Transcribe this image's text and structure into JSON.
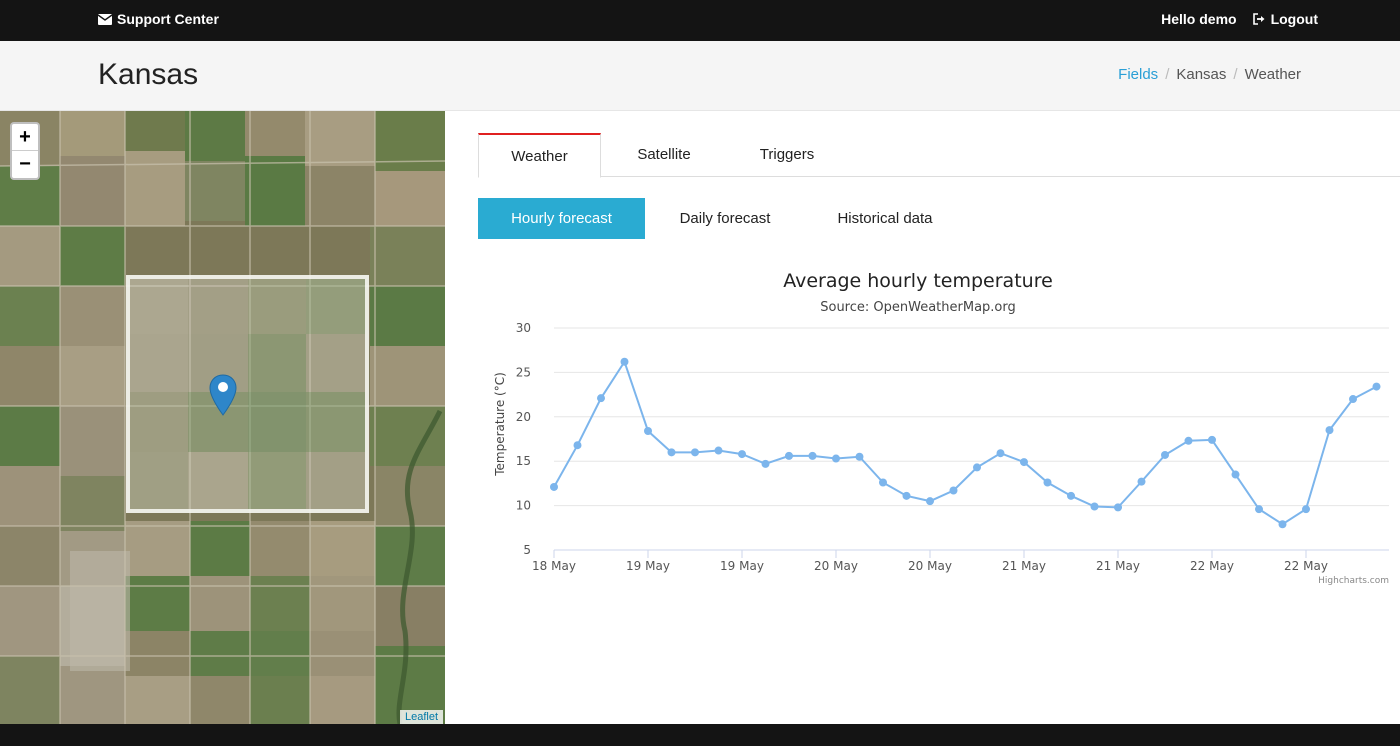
{
  "navbar": {
    "brand": "Support Center",
    "greeting": "Hello demo",
    "logout": "Logout"
  },
  "header": {
    "title": "Kansas",
    "breadcrumb": [
      "Fields",
      "Kansas",
      "Weather"
    ]
  },
  "map": {
    "zoom_in": "+",
    "zoom_out": "−",
    "attribution": "Leaflet"
  },
  "tabs": [
    "Weather",
    "Satellite",
    "Triggers"
  ],
  "subtabs": [
    "Hourly forecast",
    "Daily forecast",
    "Historical data"
  ],
  "colors": {
    "accent": "#2aabd2",
    "series": "#7cb5ec",
    "tab_active_top": "#e02020",
    "navbar": "#141414"
  },
  "chart_data": {
    "type": "line",
    "title": "Average hourly temperature",
    "subtitle": "Source: OpenWeatherMap.org",
    "ylabel": "Temperature (°C)",
    "ylim": [
      5,
      30
    ],
    "yticks": [
      5,
      10,
      15,
      20,
      25,
      30
    ],
    "xtick_labels": [
      "18 May",
      "19 May",
      "19 May",
      "20 May",
      "20 May",
      "21 May",
      "21 May",
      "22 May",
      "22 May"
    ],
    "credits": "Highcharts.com",
    "grid": true,
    "series": [
      {
        "values": [
          12.1,
          16.8,
          22.1,
          26.2,
          18.4,
          16.0,
          16.0,
          16.2,
          15.8,
          14.7,
          15.6,
          15.6,
          15.3,
          15.5,
          12.6,
          11.1,
          10.5,
          11.7,
          14.3,
          15.9,
          14.9,
          12.6,
          11.1,
          9.9,
          9.8,
          12.7,
          15.7,
          17.3,
          17.4,
          13.5,
          9.6,
          7.9,
          9.6,
          18.5,
          22.0,
          23.4
        ]
      }
    ]
  }
}
